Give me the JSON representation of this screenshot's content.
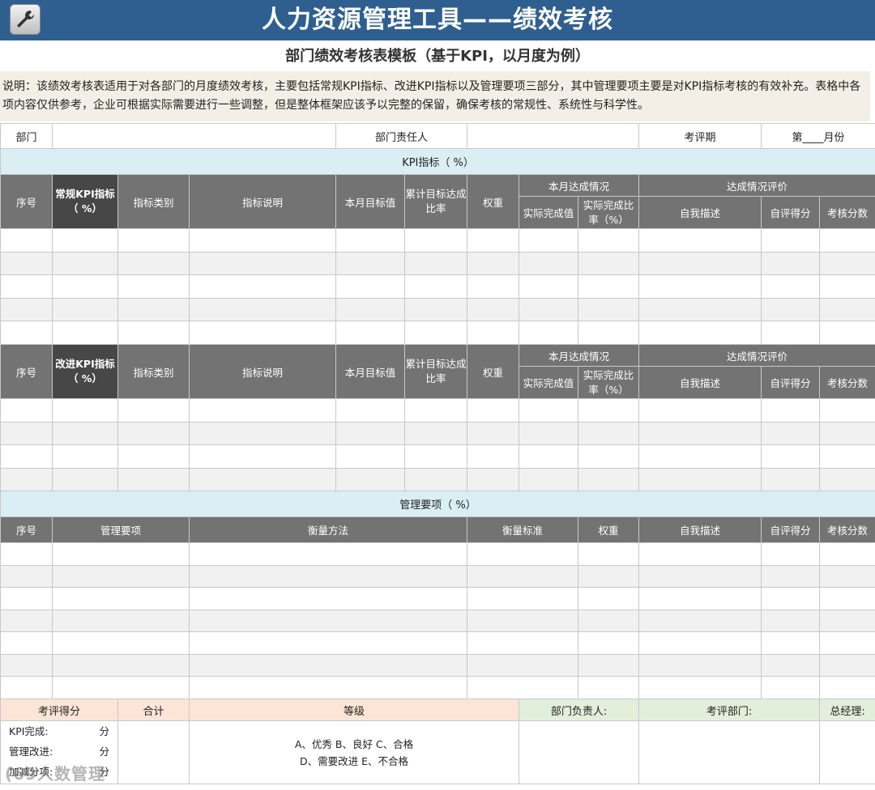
{
  "header": {
    "title": "人力资源管理工具——绩效考核",
    "subtitle": "部门绩效考核表模板（基于KPI，以月度为例）",
    "icon": "wrench-icon"
  },
  "description": "说明：该绩效考核表适用于对各部门的月度绩效考核，主要包括常规KPI指标、改进KPI指标以及管理要项三部分，其中管理要项主要是对KPI指标考核的有效补充。表格中各项内容仅供参考，企业可根据实际需要进行一些调整，但是整体框架应该予以完整的保留，确保考核的常规性、系统性与科学性。",
  "info_row": {
    "dept_label": "部门",
    "dept_value": "",
    "manager_label": "部门责任人",
    "manager_value": "",
    "period_label": "考评期",
    "period_value": "第____月份"
  },
  "kpi_section": {
    "title": "KPI指标（      %）",
    "col_seq": "序号",
    "col_regular": "常规KPI指标（  %）",
    "col_improve": "改进KPI指标（    %）",
    "col_type": "指标类别",
    "col_desc": "指标说明",
    "col_target": "本月目标值",
    "col_cumulative": "累计目标达成比率",
    "col_weight": "权重",
    "group_achieve": "本月达成情况",
    "col_actual": "实际完成值",
    "col_actual_rate": "实际完成比率（%）",
    "group_eval": "达成情况评价",
    "col_self_desc": "自我描述",
    "col_self_score": "自评得分",
    "col_review_score": "考核分数"
  },
  "mgmt_section": {
    "title": "管理要项（      %）",
    "col_seq": "序号",
    "col_item": "管理要项",
    "col_method": "衡量方法",
    "col_standard": "衡量标准",
    "col_weight": "权重",
    "col_self_desc": "自我描述",
    "col_self_score": "自评得分",
    "col_review_score": "考核分数"
  },
  "footer": {
    "score_label": "考评得分",
    "total_label": "合计",
    "grade_label": "等级",
    "dept_head_label": "部门负责人:",
    "review_dept_label": "考评部门:",
    "gm_label": "总经理:",
    "kpi_done": "KPI完成:",
    "mgmt_improve": "管理改进:",
    "bonus": "加减分项:",
    "unit": "分",
    "grade_line1": "A、优秀  B、良好  C、合格",
    "grade_line2": "D、需要改进  E、不合格"
  },
  "watermark": "(69人数管理"
}
